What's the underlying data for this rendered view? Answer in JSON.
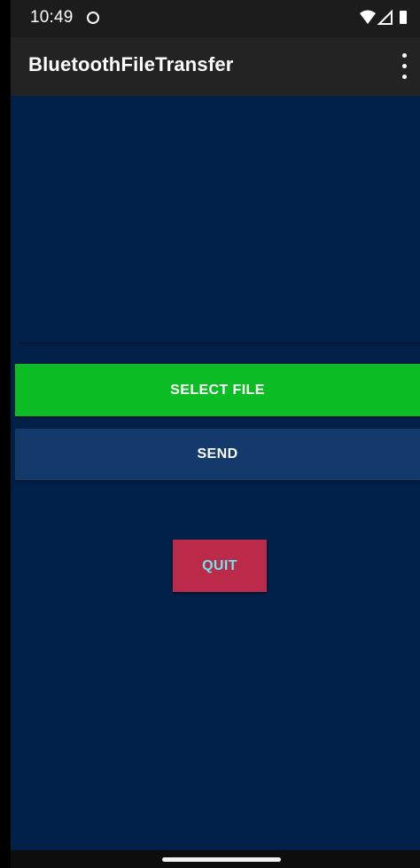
{
  "status_bar": {
    "time": "10:49",
    "icons": [
      "notification-circle-icon",
      "wifi-icon",
      "signal-icon",
      "battery-icon"
    ]
  },
  "app_bar": {
    "title": "BluetoothFileTransfer",
    "menu_icon": "overflow-menu-icon"
  },
  "actions": {
    "select_file_label": "SELECT FILE",
    "send_label": "SEND",
    "quit_label": "QUIT"
  },
  "colors": {
    "background": "#002047",
    "select_file": "#0cbc24",
    "send": "#133a6b",
    "quit": "#bb2a48",
    "quit_text": "#6ee6ee"
  }
}
